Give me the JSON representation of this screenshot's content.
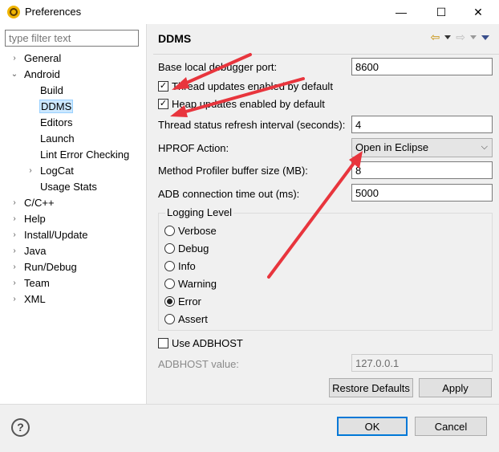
{
  "window": {
    "title": "Preferences",
    "controls": {
      "minimize": "—",
      "maximize": "☐",
      "close": "✕"
    }
  },
  "sidebar": {
    "filter_placeholder": "type filter text",
    "items": [
      {
        "label": "General",
        "arrow": "›",
        "indent": 0
      },
      {
        "label": "Android",
        "arrow": "⌄",
        "indent": 0
      },
      {
        "label": "Build",
        "arrow": "",
        "indent": 2
      },
      {
        "label": "DDMS",
        "arrow": "",
        "indent": 2,
        "selected": true
      },
      {
        "label": "Editors",
        "arrow": "",
        "indent": 2
      },
      {
        "label": "Launch",
        "arrow": "",
        "indent": 2
      },
      {
        "label": "Lint Error Checking",
        "arrow": "",
        "indent": 2
      },
      {
        "label": "LogCat",
        "arrow": "›",
        "indent": 2
      },
      {
        "label": "Usage Stats",
        "arrow": "",
        "indent": 2
      },
      {
        "label": "C/C++",
        "arrow": "›",
        "indent": 0
      },
      {
        "label": "Help",
        "arrow": "›",
        "indent": 0
      },
      {
        "label": "Install/Update",
        "arrow": "›",
        "indent": 0
      },
      {
        "label": "Java",
        "arrow": "›",
        "indent": 0
      },
      {
        "label": "Run/Debug",
        "arrow": "›",
        "indent": 0
      },
      {
        "label": "Team",
        "arrow": "›",
        "indent": 0
      },
      {
        "label": "XML",
        "arrow": "›",
        "indent": 0
      }
    ]
  },
  "page": {
    "title": "DDMS",
    "base_port_label": "Base local debugger port:",
    "base_port_value": "8600",
    "thread_updates_label": "Thread updates enabled by default",
    "thread_updates_checked": true,
    "heap_updates_label": "Heap updates enabled by default",
    "heap_updates_checked": true,
    "refresh_label": "Thread status refresh interval (seconds):",
    "refresh_value": "4",
    "hprof_label": "HPROF Action:",
    "hprof_value": "Open in Eclipse",
    "profiler_label": "Method Profiler buffer size (MB):",
    "profiler_value": "8",
    "adb_timeout_label": "ADB connection time out (ms):",
    "adb_timeout_value": "5000",
    "logging": {
      "title": "Logging Level",
      "options": [
        "Verbose",
        "Debug",
        "Info",
        "Warning",
        "Error",
        "Assert"
      ],
      "selected": "Error"
    },
    "use_adbhost_label": "Use ADBHOST",
    "use_adbhost_checked": false,
    "adbhost_label": "ADBHOST value:",
    "adbhost_value": "127.0.0.1",
    "restore_label": "Restore Defaults",
    "apply_label": "Apply"
  },
  "footer": {
    "help": "?",
    "ok_label": "OK",
    "cancel_label": "Cancel"
  },
  "colors": {
    "annotation_arrow": "#e8353d",
    "selection": "#cce8ff",
    "default_button_border": "#0078d7"
  }
}
